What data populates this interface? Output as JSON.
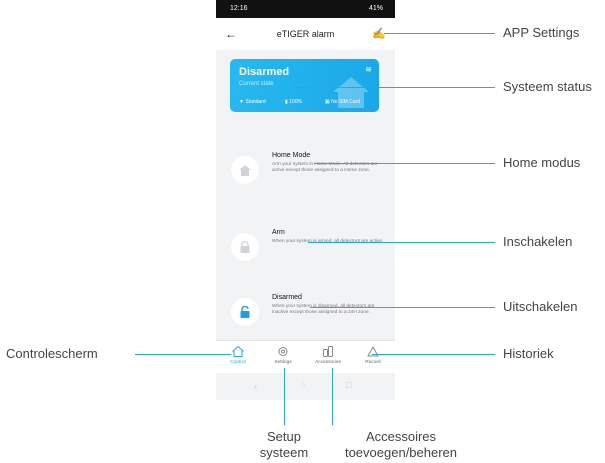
{
  "status_bar": {
    "time": "12:16",
    "right": "41%"
  },
  "app_bar": {
    "title": "eTIGER alarm"
  },
  "status_card": {
    "state": "Disarmed",
    "subtitle": "Current state",
    "signal": "Standard",
    "battery": "100%",
    "sim": "No SIM Card"
  },
  "modes": [
    {
      "name": "Home Mode",
      "description": "Arm your system in Home Mode. All detectors are active except those assigned to a Home zone."
    },
    {
      "name": "Arm",
      "description": "When your system is armed, all detectors are active."
    },
    {
      "name": "Disarmed",
      "description": "When your system is disarmed, all detectors are inactive except those assigned to a 24H zone."
    }
  ],
  "tabs": [
    {
      "label": "Control",
      "active": true
    },
    {
      "label": "Settings"
    },
    {
      "label": "Accessories"
    },
    {
      "label": "Record"
    }
  ],
  "callouts": {
    "app_settings": "APP Settings",
    "systeem_status": "Systeem status",
    "home_modus": "Home modus",
    "inschakelen": "Inschakelen",
    "uitschakelen": "Uitschakelen",
    "historiek": "Historiek",
    "controlescherm": "Controlescherm",
    "setup_line1": "Setup",
    "setup_line2": "systeem",
    "accessoires_line1": "Accessoires",
    "accessoires_line2": "toevoegen/beheren"
  },
  "colors": {
    "accent": "#29a8e0",
    "card": "#1fb0ec",
    "disarmed_icon": "#1e9ee3",
    "inactive_icon": "#d0d3d8"
  }
}
